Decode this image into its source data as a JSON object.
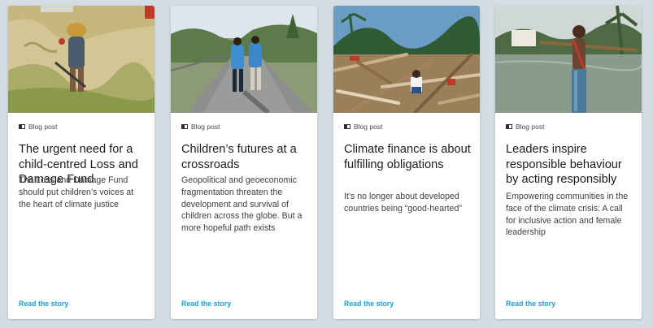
{
  "cards": [
    {
      "image_alt": "Child carrying a bundle past a weathered wall",
      "meta_label": "Blog post",
      "meta_icon": "blog-post-icon",
      "title": "The urgent need for a child-centred Loss and Damage Fund",
      "description": "The Loss and Damage Fund should put children’s voices at the heart of climate justice",
      "link_label": "Read the story"
    },
    {
      "image_alt": "Two children with backpacks walking on a road",
      "meta_label": "Blog post",
      "meta_icon": "blog-post-icon",
      "title": "Children’s futures at a crossroads",
      "description": "Geopolitical and geoeconomic fragmentation threaten the development and survival of children across the globe. But a more hopeful path exists",
      "link_label": "Read the story"
    },
    {
      "image_alt": "Child sitting amid storm debris",
      "meta_label": "Blog post",
      "meta_icon": "blog-post-icon",
      "title": "Climate finance is about fulfilling obligations",
      "description": "It’s no longer about developed countries being “good-hearted”",
      "link_label": "Read the story"
    },
    {
      "image_alt": "Young man carrying a pole beside floodwater",
      "meta_label": "Blog post",
      "meta_icon": "blog-post-icon",
      "title": "Leaders inspire responsible behaviour by acting responsibly",
      "description": "Empowering communities in the face of the climate crisis: A call for inclusive action and female leadership",
      "link_label": "Read the story"
    }
  ],
  "colors": {
    "page_bg": "#d4dde3",
    "card_bg": "#ffffff",
    "link": "#1ca0d6",
    "title": "#1c1c1c",
    "body": "#3a3f44"
  }
}
